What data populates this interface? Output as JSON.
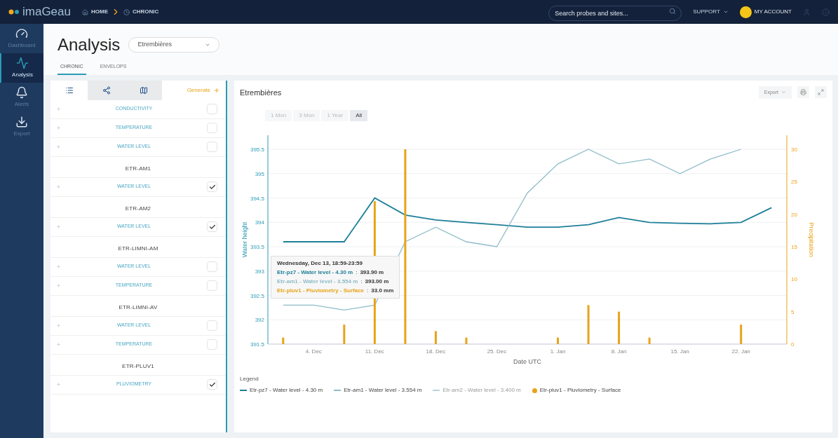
{
  "topbar": {
    "logo": "imaGeau",
    "breadcrumb": [
      {
        "label": "HOME"
      },
      {
        "label": "CHRONIC"
      }
    ],
    "search": {
      "placeholder": "Search probes and sites..."
    },
    "support": "SUPPORT",
    "account": "MY ACCOUNT"
  },
  "nav": [
    {
      "label": "Dashboard",
      "selected": false
    },
    {
      "label": "Analysis",
      "selected": true
    },
    {
      "label": "Alerts",
      "selected": false
    },
    {
      "label": "Export",
      "selected": false
    }
  ],
  "page": {
    "title": "Analysis",
    "site": "Etrembières",
    "tabs": [
      {
        "label": "CHRONIC",
        "selected": true
      },
      {
        "label": "ENVELOPS",
        "selected": false
      }
    ]
  },
  "panel": {
    "tabs": [
      {
        "kind": "list",
        "selected": true
      },
      {
        "kind": "share",
        "selected": false
      },
      {
        "kind": "map",
        "selected": false
      }
    ],
    "generate": "Generate",
    "groups": [
      {
        "items": [
          {
            "label": "CONDUCTIVITY",
            "checked": false
          },
          {
            "label": "TEMPERATURE",
            "checked": false
          },
          {
            "label": "WATER LEVEL",
            "checked": false
          }
        ]
      },
      {
        "name": "ETR-AM1",
        "items": [
          {
            "label": "WATER LEVEL",
            "checked": true
          }
        ]
      },
      {
        "name": "ETR-AM2",
        "items": [
          {
            "label": "WATER LEVEL",
            "checked": true
          }
        ]
      },
      {
        "name": "ETR-LIMNI-AM",
        "items": [
          {
            "label": "WATER LEVEL",
            "checked": false
          },
          {
            "label": "TEMPERATURE",
            "checked": false
          }
        ]
      },
      {
        "name": "ETR-LIMNI-AV",
        "items": [
          {
            "label": "WATER LEVEL",
            "checked": false
          },
          {
            "label": "TEMPERATURE",
            "checked": false
          }
        ]
      },
      {
        "name": "ETR-PLUV1",
        "items": [
          {
            "label": "PLUVIOMETRY",
            "checked": true
          }
        ]
      }
    ]
  },
  "chart": {
    "title": "Etrembières",
    "export": "Export",
    "ranges": [
      {
        "label": "1 Mon",
        "selected": false
      },
      {
        "label": "3 Mon",
        "selected": false
      },
      {
        "label": "1 Year",
        "selected": false
      },
      {
        "label": "All",
        "selected": true
      }
    ],
    "chart_data": {
      "type": "line",
      "xlabel": "Date UTC",
      "ylabel": "Water height",
      "grid": true,
      "categories": [
        null,
        "4. Dec",
        null,
        "11. Dec",
        null,
        "18. Dec",
        null,
        "25. Dec",
        null,
        "1. Jan",
        null,
        "8. Jan",
        null,
        "15. Jan",
        null,
        "22. Jan",
        null
      ],
      "ylim": [
        391.5,
        395.5
      ],
      "yticks": [
        391.5,
        392,
        392.5,
        393,
        393.5,
        394,
        394.5,
        395,
        395.5
      ],
      "series": [
        {
          "name": "Etr-pz7 - Water level - 4.30 m",
          "color": "#1d7f99",
          "values": [
            393.6,
            393.6,
            393.6,
            394.5,
            394.15,
            394.05,
            394.0,
            393.95,
            393.9,
            393.9,
            393.95,
            394.1,
            394.0,
            393.98,
            393.97,
            394.0,
            394.3
          ]
        },
        {
          "name": "Etr-am1 - Water level - 3.554 m",
          "color": "#8fbcc8",
          "values": [
            392.3,
            392.3,
            392.2,
            392.3,
            393.6,
            393.9,
            393.6,
            393.5,
            394.6,
            395.2,
            395.5,
            395.2,
            395.3,
            395.0,
            395.3,
            395.5,
            null
          ]
        },
        {
          "name": "Etr-am2 - Water level - 3.400 m",
          "color": "#b9d3db",
          "values": [
            null,
            null,
            null,
            null,
            null,
            null,
            null,
            null,
            null,
            null,
            null,
            null,
            null,
            null,
            null,
            null,
            null
          ]
        }
      ]
    },
    "precipitation": {
      "chart_data": {
        "type": "bar",
        "ylabel": "Precipitation",
        "ylim": [
          0,
          30
        ],
        "yticks": [
          0,
          5,
          10,
          15,
          20,
          25,
          30
        ],
        "series": [
          {
            "name": "Etr-pluv1 - Pluviometry - Surface",
            "color": "#e8a317",
            "values": [
              1,
              null,
              3,
              22,
              30,
              2,
              1,
              null,
              null,
              1,
              6,
              5,
              1,
              null,
              null,
              3,
              null
            ]
          }
        ]
      }
    },
    "tooltip": {
      "title": "Wednesday, Dec 13, 18:59-23:59",
      "separator": ":",
      "lines": [
        {
          "label": "Etr-pz7 - Water level - 4.30 m",
          "value": "393.90 m",
          "color": "#1d7f99"
        },
        {
          "label": "Etr-am1 - Water level - 3.554 m",
          "value": "393.00 m",
          "color": "#8fbcc8"
        },
        {
          "label": "Etr-pluv1 - Pluviometry - Surface",
          "value": "33.0 mm",
          "color": "#e8a317"
        }
      ]
    },
    "legend_title": "Legend",
    "legend": [
      {
        "disabled": false
      },
      {
        "disabled": false
      },
      {
        "disabled": true
      },
      {
        "disabled": false
      }
    ]
  }
}
